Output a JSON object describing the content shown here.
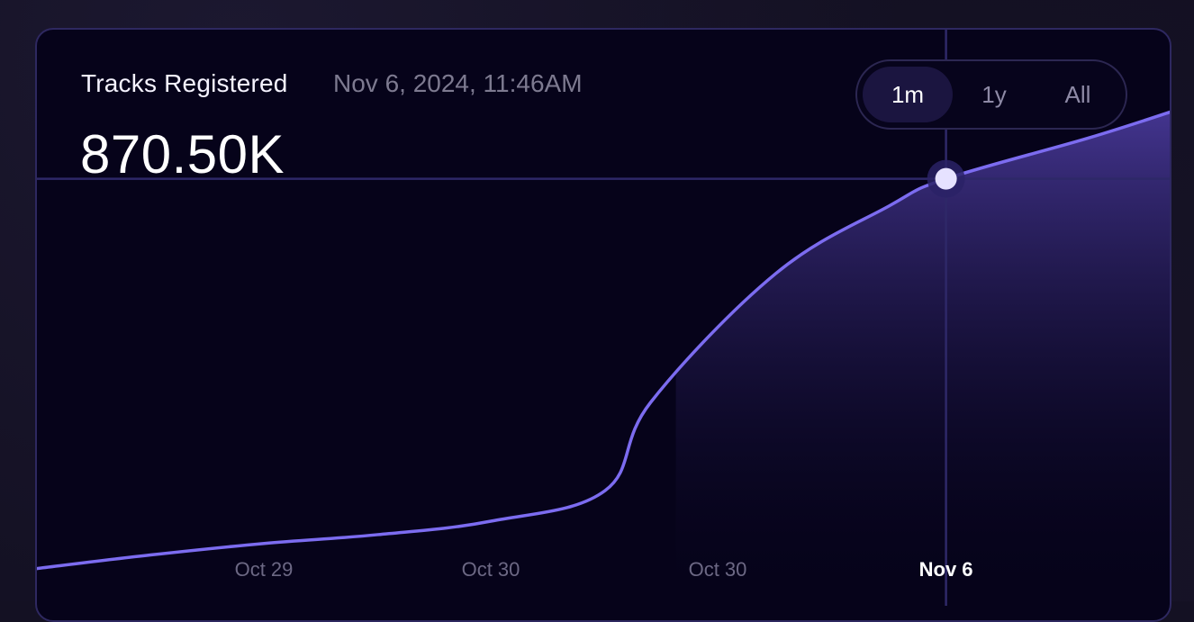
{
  "header": {
    "title": "Tracks Registered",
    "timestamp": "Nov 6, 2024, 11:46AM",
    "value": "870.50K"
  },
  "range_toggle": {
    "options": [
      "1m",
      "1y",
      "All"
    ],
    "selected": "1m"
  },
  "colors": {
    "line": "#7c6cf0",
    "fill_top": "#4a3a9c",
    "crosshair": "#2e2868",
    "marker": "#e6e2ff",
    "marker_ring": "#2a2266"
  },
  "chart_data": {
    "type": "area",
    "title": "Tracks Registered",
    "x_tick_labels": [
      "Oct 29",
      "Oct 30",
      "Oct 30",
      "Nov 6"
    ],
    "active_tick_label": "Nov 6",
    "x": [
      0,
      2,
      4,
      6,
      8,
      10,
      10.8,
      13,
      15,
      16,
      18.5,
      20
    ],
    "y": [
      355,
      375,
      392,
      405,
      425,
      470,
      600,
      790,
      890,
      930,
      990,
      1030
    ],
    "selected_point": {
      "x": 16,
      "y": 930,
      "label": "Nov 6, 2024, 11:46AM",
      "display_value": "870.50K"
    },
    "x_range": [
      0,
      20
    ],
    "y_range": [
      300,
      1150
    ],
    "grid": false,
    "legend": "none"
  }
}
